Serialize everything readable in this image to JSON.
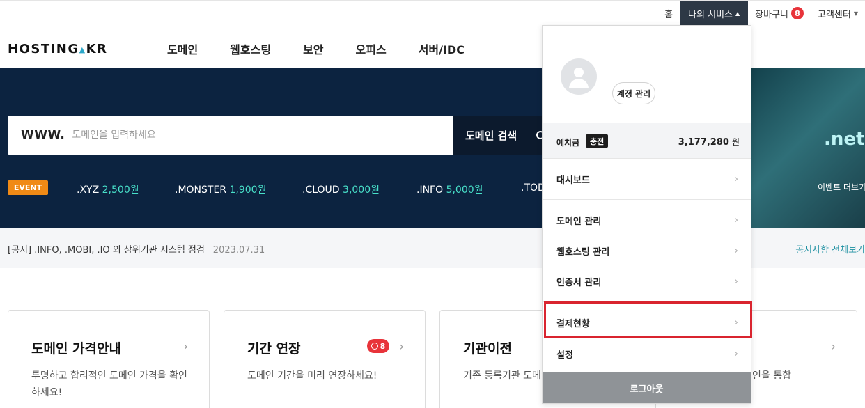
{
  "topbar": {
    "home": "홈",
    "my_service": "나의 서비스",
    "cart": "장바구니",
    "cart_count": "8",
    "support": "고객센터"
  },
  "header": {
    "logo_part1": "HOSTING",
    "logo_part2": "KR",
    "nav": [
      "도메인",
      "웹호스팅",
      "보안",
      "오피스",
      "서버/IDC"
    ]
  },
  "hero": {
    "www": "WWW.",
    "search_placeholder": "도메인을 입력하세요",
    "search_button": "도메인 검색",
    "event_tag": "EVENT",
    "promos": [
      {
        "ext": ".XYZ",
        "price": "2,500원"
      },
      {
        "ext": ".MONSTER",
        "price": "1,900원"
      },
      {
        "ext": ".CLOUD",
        "price": "3,000원"
      },
      {
        "ext": ".INFO",
        "price": "5,000원"
      },
      {
        "ext": ".TOD",
        "price": ""
      }
    ],
    "banner_text": ".net",
    "banner_sub": "이벤트 더보기"
  },
  "notice": {
    "text": "[공지] .INFO, .MOBI, .IO 외 상위기관 시스템 점검",
    "date": "2023.07.31",
    "view_all": "공지사항 전체보기"
  },
  "cards": [
    {
      "title": "도메인 가격안내",
      "desc": "투명하고 합리적인 도메인 가격을 확인하세요!"
    },
    {
      "title": "기간 연장",
      "desc": "도메인 기간을 미리 연장하세요!",
      "badge": "8"
    },
    {
      "title": "기관이전",
      "desc": "기존 등록기관 도메인을 옮기세요!"
    },
    {
      "title": "",
      "desc": "인을 통합"
    }
  ],
  "dropdown": {
    "account_button": "계정 관리",
    "deposit_label": "예치금",
    "charge_button": "충전",
    "deposit_amount": "3,177,280",
    "deposit_unit": "원",
    "menu": {
      "dashboard": "대시보드",
      "domain_mgmt": "도메인 관리",
      "hosting_mgmt": "웹호스팅 관리",
      "cert_mgmt": "인증서 관리",
      "payment_status": "결제현황",
      "settings": "설정"
    },
    "logout": "로그아웃"
  }
}
